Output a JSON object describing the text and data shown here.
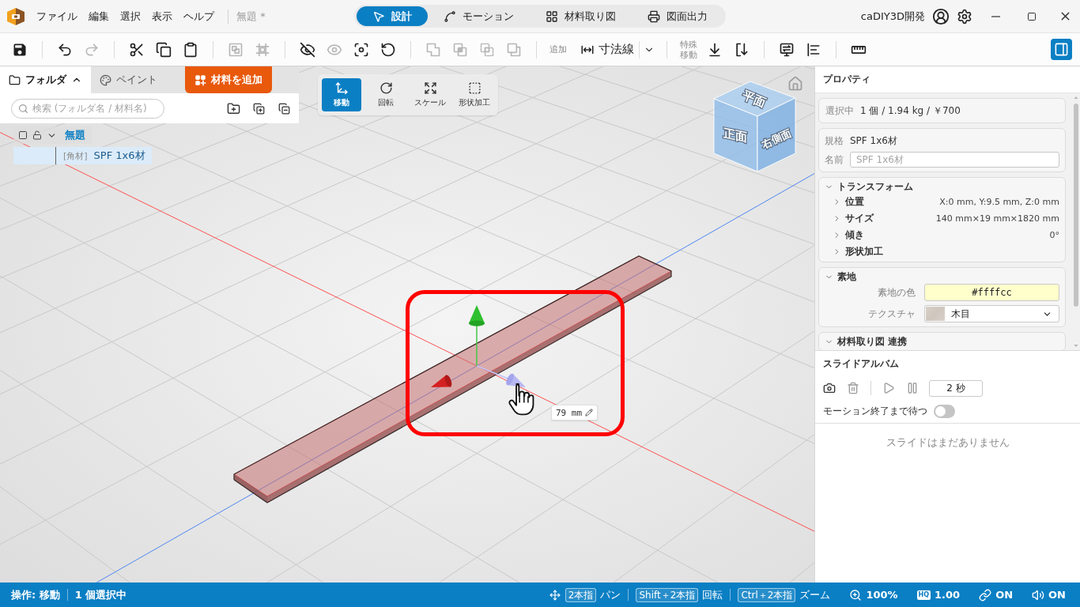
{
  "title_bar": {
    "menu": [
      "ファイル",
      "編集",
      "選択",
      "表示",
      "ヘルプ"
    ],
    "document_title": "無題 *",
    "mode_tabs": [
      {
        "label": "設計",
        "selected": true
      },
      {
        "label": "モーション",
        "selected": false
      },
      {
        "label": "材料取り図",
        "selected": false
      },
      {
        "label": "図面出力",
        "selected": false
      }
    ],
    "account": "caDIY3D開発"
  },
  "toolbar": {
    "groups": [
      [
        {
          "kind": "icon",
          "disabled": false
        }
      ],
      [
        {
          "kind": "icon",
          "disabled": false
        },
        {
          "kind": "icon",
          "disabled": true
        }
      ],
      [
        {
          "kind": "icon",
          "disabled": false
        },
        {
          "kind": "icon",
          "disabled": false
        },
        {
          "kind": "icon",
          "disabled": false
        }
      ],
      [
        {
          "kind": "icon",
          "disabled": true
        },
        {
          "kind": "icon",
          "disabled": true
        }
      ],
      [
        {
          "kind": "icon",
          "disabled": false
        },
        {
          "kind": "icon",
          "disabled": true
        },
        {
          "kind": "icon",
          "disabled": false
        },
        {
          "kind": "icon",
          "disabled": false
        }
      ],
      [
        {
          "kind": "icon",
          "disabled": true
        },
        {
          "kind": "icon",
          "disabled": true
        },
        {
          "kind": "icon",
          "disabled": true
        },
        {
          "kind": "icon",
          "disabled": true
        }
      ],
      [
        {
          "kind": "caption",
          "text": "追加"
        },
        {
          "kind": "tool",
          "label": "寸法線"
        },
        {
          "kind": "menu"
        }
      ],
      [
        {
          "kind": "caption",
          "text": "特殊移動"
        },
        {
          "kind": "icon",
          "disabled": false
        },
        {
          "kind": "icon",
          "disabled": false
        }
      ],
      [
        {
          "kind": "icon",
          "disabled": false
        },
        {
          "kind": "icon",
          "disabled": false
        }
      ],
      [
        {
          "kind": "icon",
          "disabled": false
        }
      ]
    ],
    "panel_toggle": {
      "on": true
    }
  },
  "folder_panel": {
    "expanded": true,
    "tabs": [
      {
        "label": "フォルダ",
        "selected": true
      },
      {
        "label": "ペイント",
        "selected": false
      }
    ],
    "add_button": "材料を追加",
    "search": {
      "placeholder": "検索 (フォルダ名 / 材料名)"
    },
    "tree": [
      {
        "label": "無題",
        "checked": false,
        "locked": false,
        "expanded": true,
        "selected": false,
        "children": [
          {
            "tag": "[角材]",
            "label": "SPF 1x6材",
            "selected": true
          }
        ]
      }
    ]
  },
  "viewport": {
    "tools": [
      {
        "label": "移動",
        "selected": true
      },
      {
        "label": "回転",
        "selected": false
      },
      {
        "label": "スケール",
        "selected": false
      },
      {
        "label": "形状加工",
        "selected": false
      }
    ],
    "view_cube": {
      "top": "平面",
      "front": "正面",
      "right": "右側面"
    },
    "dimension": "79 mm"
  },
  "properties": {
    "title": "プロパティ",
    "selection": {
      "label": "選択中",
      "value": "1 個 / 1.94 kg / ￥700"
    },
    "spec": {
      "label": "規格",
      "value": "SPF 1x6材"
    },
    "name": {
      "label": "名前",
      "placeholder": "SPF 1x6材"
    },
    "sections": [
      {
        "kind": "rows",
        "title": "トランスフォーム",
        "expanded": true,
        "rows": [
          {
            "label": "位置",
            "value": "X:0 mm, Y:9.5 mm, Z:0 mm",
            "expanded": false
          },
          {
            "label": "サイズ",
            "value": "140 mm×19 mm×1820 mm",
            "expanded": false
          },
          {
            "label": "傾き",
            "value": "0°",
            "expanded": false
          },
          {
            "label": "形状加工",
            "expanded": false
          }
        ]
      },
      {
        "kind": "fields",
        "title": "素地",
        "expanded": true,
        "fields": [
          {
            "kind": "color",
            "label": "素地の色",
            "value": "#ffffcc"
          },
          {
            "kind": "select",
            "label": "テクスチャ",
            "value": "木目"
          }
        ]
      },
      {
        "kind": "rows",
        "title": "材料取り図 連携",
        "expanded": true
      }
    ]
  },
  "slide_album": {
    "title": "スライドアルバム",
    "controls": [
      {
        "disabled": false
      },
      {
        "disabled": true
      },
      {
        "disabled": true
      },
      {
        "disabled": true
      }
    ],
    "interval": "2 秒",
    "wait_toggle": {
      "label": "モーション終了まで待つ",
      "on": false
    },
    "empty_message": "スライドはまだありません"
  },
  "status_bar": {
    "operation": "操作: 移動",
    "selection": "1 個選択中",
    "gestures": [
      {
        "keys": "2本指",
        "action": "パン"
      },
      {
        "keys": "Shift＋2本指",
        "action": "回転"
      },
      {
        "keys": "Ctrl＋2本指",
        "action": "ズーム"
      }
    ],
    "zoom": "100%",
    "quality_badge": "HQ",
    "quality": "1.00",
    "link": "ON",
    "sound": "ON"
  }
}
